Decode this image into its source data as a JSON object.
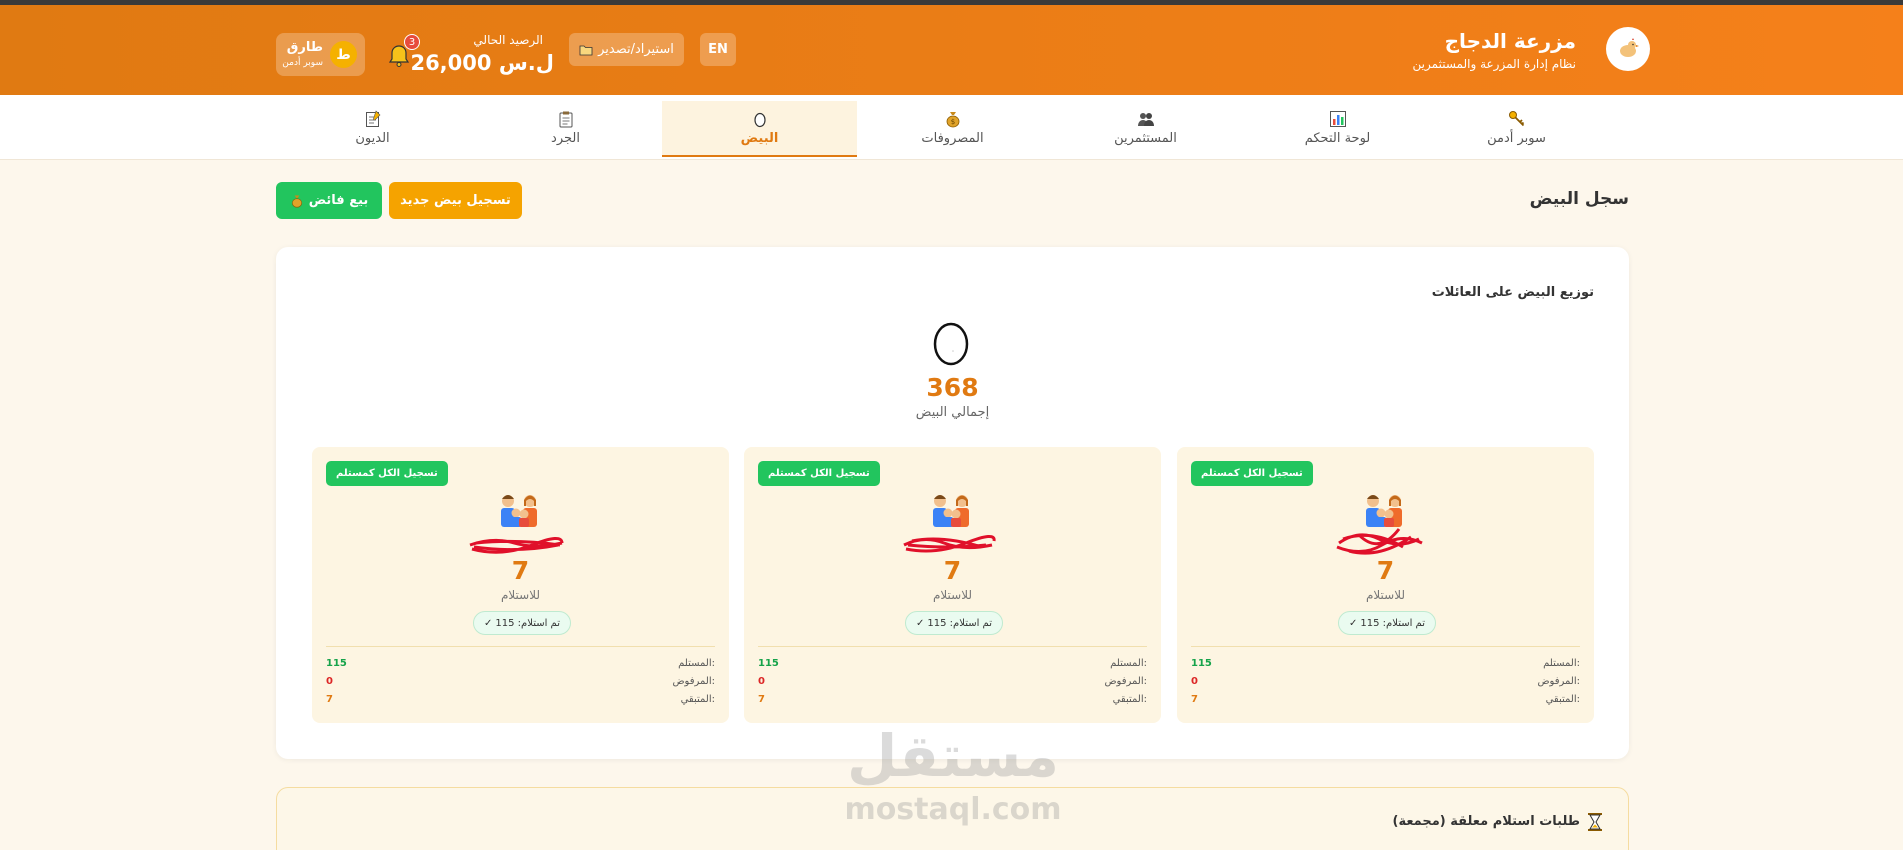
{
  "header": {
    "brand_title": "مزرعة الدجاج",
    "brand_subtitle": "نظام إدارة المزرعة والمستثمرين",
    "lang_button": "EN",
    "import_export_label": "استيراد/تصدير",
    "balance_label": "الرصيد الحالي",
    "balance_value": "26,000 ل.س",
    "notifications_count": "3",
    "user": {
      "initial": "ط",
      "name": "طارق",
      "role": "سوبر أدمن"
    },
    "colors": {
      "accent": "#f5801a",
      "accent_dark": "#e07a12"
    }
  },
  "nav": {
    "items": [
      {
        "label": "سوبر أدمن",
        "icon": "key-icon"
      },
      {
        "label": "لوحة التحكم",
        "icon": "bar-chart-icon"
      },
      {
        "label": "المستثمرين",
        "icon": "people-icon"
      },
      {
        "label": "المصروفات",
        "icon": "money-bag-icon"
      },
      {
        "label": "البيض",
        "icon": "egg-icon",
        "active": true
      },
      {
        "label": "الجرد",
        "icon": "clipboard-icon"
      },
      {
        "label": "الديون",
        "icon": "memo-icon"
      }
    ]
  },
  "page": {
    "title": "سجل البيض",
    "new_egg_button": "تسجيل بيض جديد",
    "surplus_sale_button": "بيع فائض"
  },
  "distribution": {
    "title": "توزيع البيض على العائلات",
    "total_eggs": "368",
    "total_label": "إجمالي البيض",
    "families": [
      {
        "register_all_label": "تسجيل الكل كمستلم",
        "remaining": "7",
        "remaining_label": "للاستلام",
        "received_chip": "تم استلام: 115",
        "stats": {
          "received_label": "المستلم:",
          "received": "115",
          "rejected_label": "المرفوض:",
          "rejected": "0",
          "left_label": "المتبقي:",
          "left": "7"
        }
      },
      {
        "register_all_label": "تسجيل الكل كمستلم",
        "remaining": "7",
        "remaining_label": "للاستلام",
        "received_chip": "تم استلام: 115",
        "stats": {
          "received_label": "المستلم:",
          "received": "115",
          "rejected_label": "المرفوض:",
          "rejected": "0",
          "left_label": "المتبقي:",
          "left": "7"
        }
      },
      {
        "register_all_label": "تسجيل الكل كمستلم",
        "remaining": "7",
        "remaining_label": "للاستلام",
        "received_chip": "تم استلام: 115",
        "stats": {
          "received_label": "المستلم:",
          "received": "115",
          "rejected_label": "المرفوض:",
          "rejected": "0",
          "left_label": "المتبقي:",
          "left": "7"
        }
      }
    ]
  },
  "pending": {
    "title": "طلبات استلام معلقة (مجمعة)"
  },
  "watermark": {
    "arabic": "مستقل",
    "latin": "mostaql.com"
  }
}
